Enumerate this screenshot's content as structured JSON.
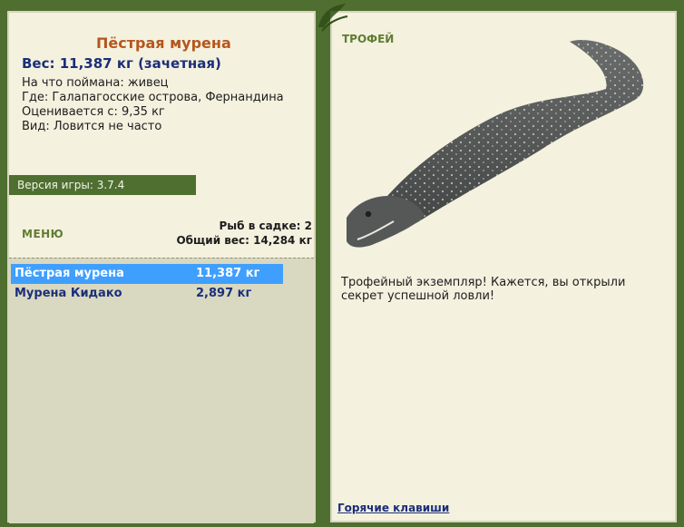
{
  "fish": {
    "name": "Пёстрая мурена",
    "weight_title": "Вес: 11,387 кг (зачетная)",
    "caught_on": "На что поймана: живец",
    "location": "Где: Галапагосские острова, Фернандина",
    "valued_from": "Оценивается с: 9,35 кг",
    "rarity": "Вид: Ловится не часто"
  },
  "version": "Версия игры: 3.7.4",
  "menu_label": "МЕНЮ",
  "cage": {
    "fish_count": "Рыб в садке: 2",
    "total_weight": "Общий вес: 14,284 кг"
  },
  "catch_list": [
    {
      "name": "Пёстрая мурена",
      "weight": "11,387 кг"
    },
    {
      "name": "Мурена Кидако",
      "weight": "2,897 кг"
    }
  ],
  "trophy": {
    "label": "ТРОФЕЙ",
    "message": "Трофейный экземпляр! Кажется, вы открыли секрет успешной ловли!"
  },
  "hotkeys_link": "Горячие клавиши",
  "icons": {
    "decor": "leaf-decoration-icon",
    "fish_image": "moray-eel-illustration"
  },
  "colors": {
    "frame_green": "#4f6f30",
    "panel_bg": "#f4f1df",
    "selection_blue": "#3f9fff",
    "accent_orange": "#b5561d",
    "title_blue": "#1b2e7a"
  }
}
